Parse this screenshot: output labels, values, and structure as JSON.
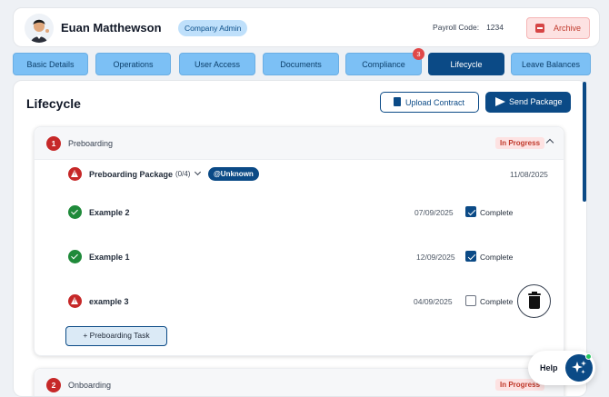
{
  "header": {
    "user_name": "Euan Matthewson",
    "role": "Company Admin",
    "payroll_label": "Payroll Code:",
    "payroll_code": "1234",
    "archive_label": "Archive"
  },
  "tabs": [
    {
      "label": "Basic Details"
    },
    {
      "label": "Operations"
    },
    {
      "label": "User Access"
    },
    {
      "label": "Documents"
    },
    {
      "label": "Compliance",
      "badge": "3"
    },
    {
      "label": "Lifecycle",
      "active": true
    },
    {
      "label": "Leave Balances"
    }
  ],
  "page": {
    "title": "Lifecycle",
    "upload_label": "Upload Contract",
    "send_label": "Send Package"
  },
  "sections": [
    {
      "number": "1",
      "title": "Preboarding",
      "status": "In Progress",
      "package": {
        "name": "Preboarding Package",
        "count": "(0/4)",
        "assignee": "@Unknown",
        "date": "11/08/2025"
      },
      "tasks": [
        {
          "name": "Example 2",
          "date": "07/09/2025",
          "complete_label": "Complete",
          "checked": true
        },
        {
          "name": "Example 1",
          "date": "12/09/2025",
          "complete_label": "Complete",
          "checked": true
        },
        {
          "name": "example 3",
          "date": "04/09/2025",
          "complete_label": "Complete",
          "checked": false
        }
      ],
      "add_task_label": "+ Preboarding Task"
    },
    {
      "number": "2",
      "title": "Onboarding",
      "status": "In Progress"
    }
  ],
  "help": {
    "label": "Help"
  },
  "colors": {
    "primary": "#0b4a86",
    "tab_inactive": "#7cc0f5",
    "danger": "#c62828",
    "success": "#1f8a3a"
  }
}
